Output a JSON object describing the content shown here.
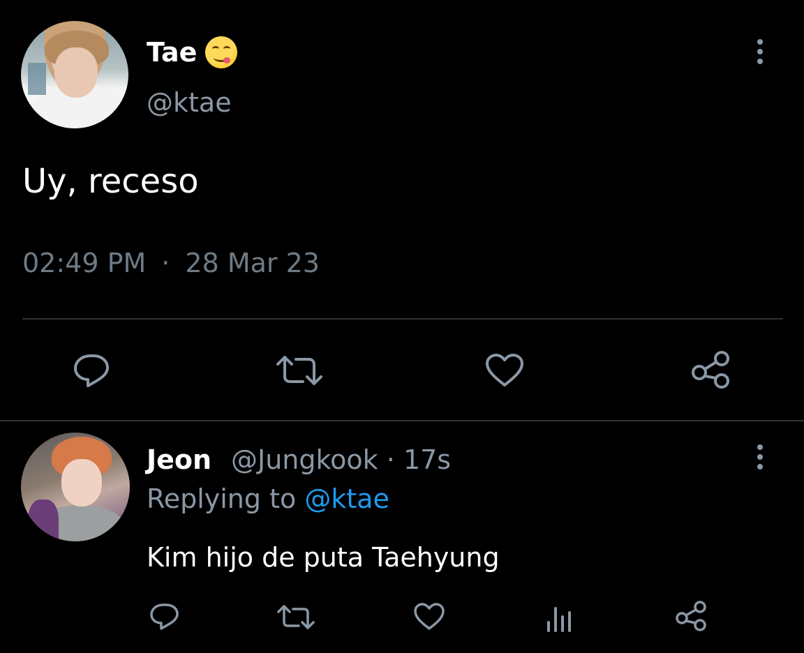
{
  "main_tweet": {
    "author_name": "Tae",
    "author_emoji": "😋",
    "author_handle": "@ktae",
    "text": "Uy, receso",
    "time": "02:49 PM",
    "separator": "·",
    "date": "28 Mar 23",
    "actions": {
      "reply_icon": "reply-icon",
      "retweet_icon": "retweet-icon",
      "like_icon": "like-icon",
      "share_icon": "share-icon"
    },
    "more_icon": "more-icon"
  },
  "reply_tweet": {
    "author_name": "Jeon",
    "author_handle": "@Jungkook",
    "separator": "·",
    "time_ago": "17s",
    "replying_prefix": "Replying to",
    "replying_to": "@ktae",
    "text": "Kim hijo de puta Taehyung",
    "actions": {
      "reply_icon": "reply-icon",
      "retweet_icon": "retweet-icon",
      "like_icon": "like-icon",
      "views_icon": "views-icon",
      "share_icon": "share-icon"
    },
    "more_icon": "more-icon"
  },
  "colors": {
    "background": "#000000",
    "text_primary": "#ffffff",
    "text_secondary": "#8b98a5",
    "accent": "#1d9bf0",
    "divider": "#2f3336"
  }
}
